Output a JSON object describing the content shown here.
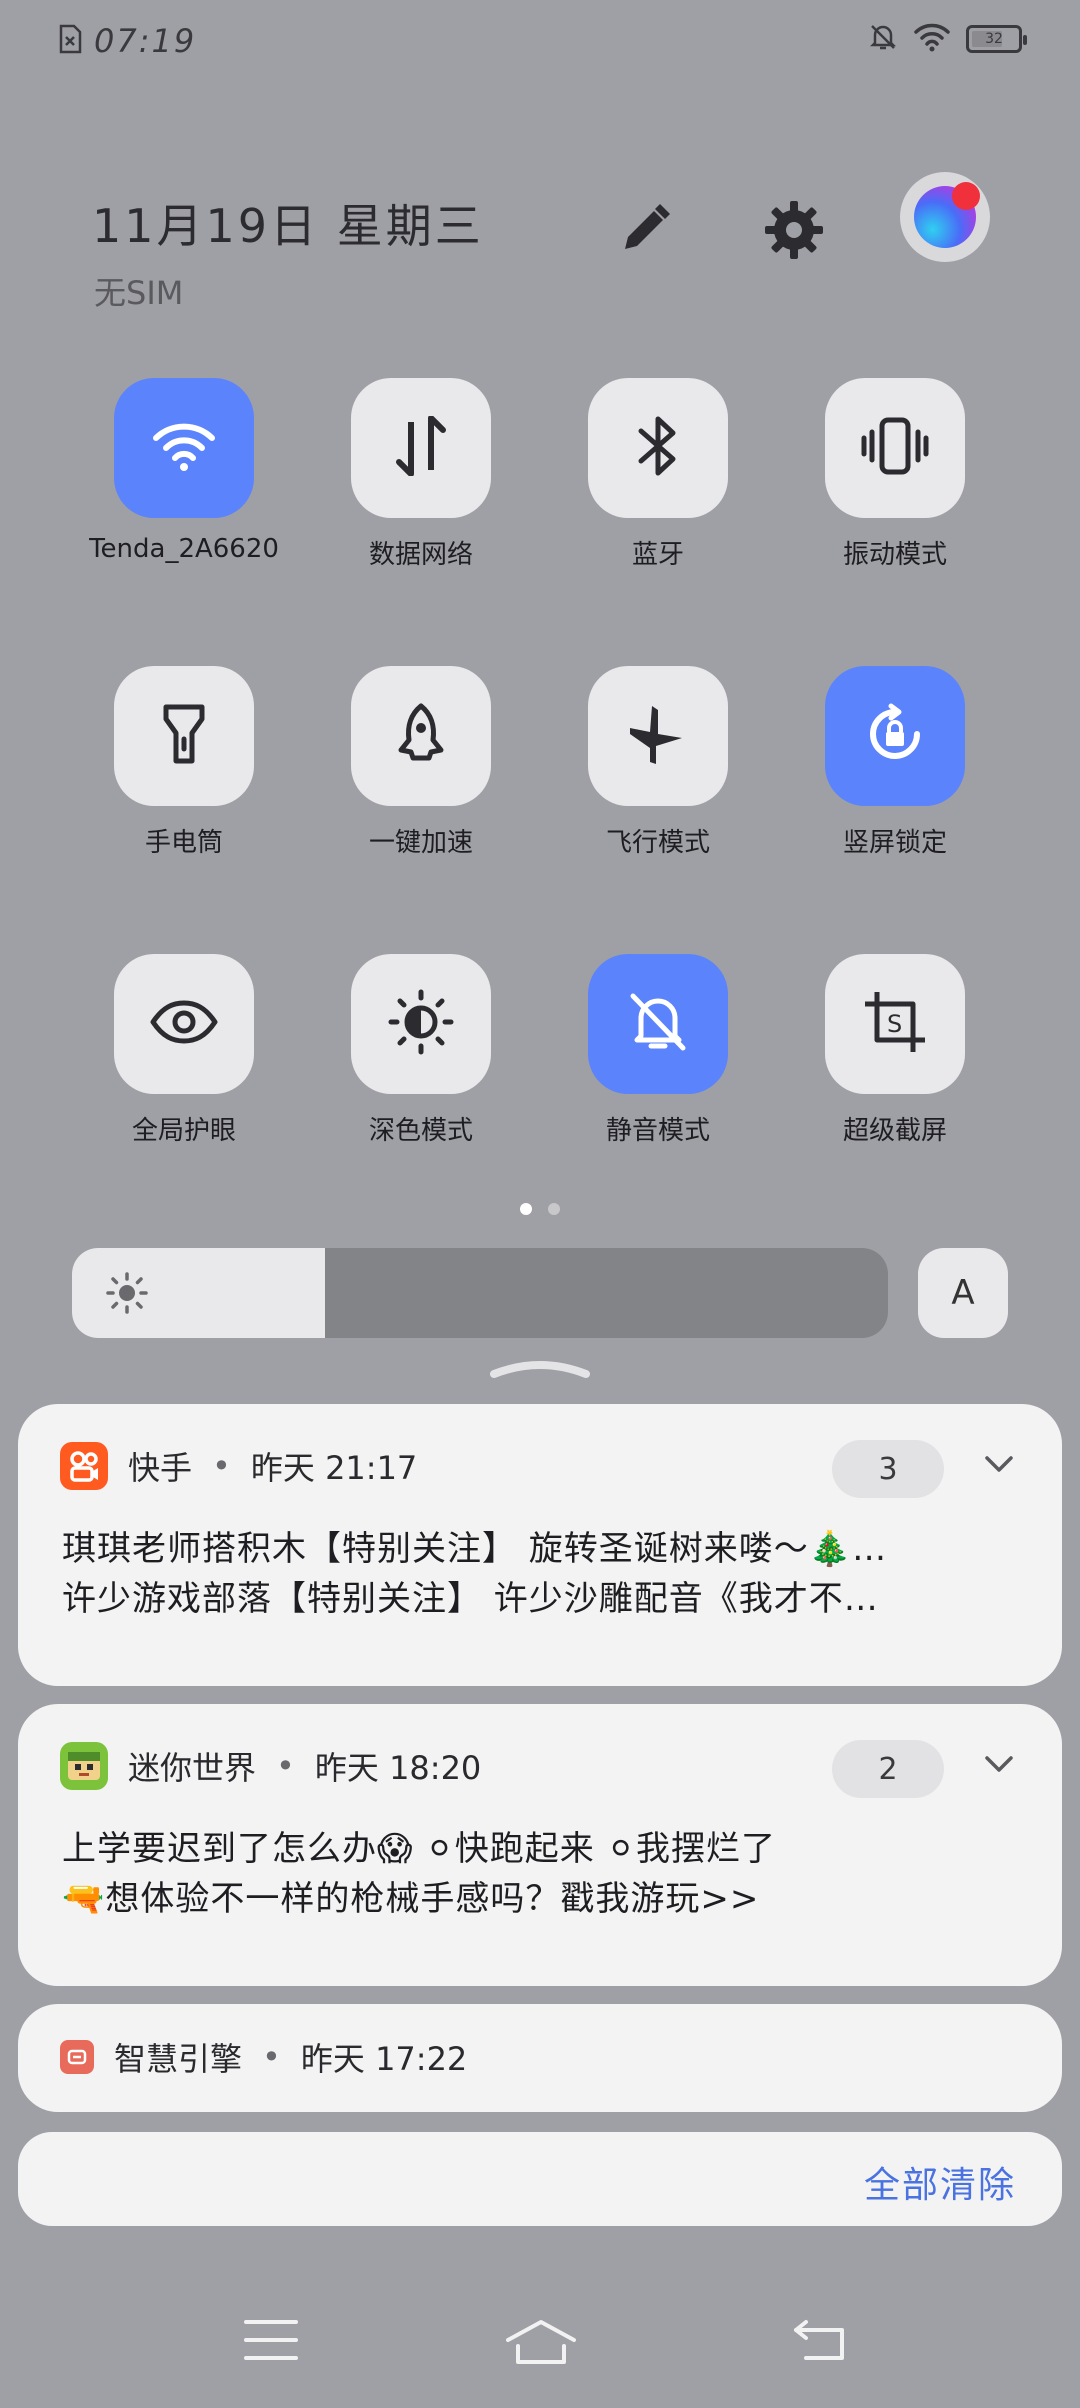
{
  "status_bar": {
    "time": "07:19",
    "battery_level": "32",
    "icons": [
      "sim-error-icon",
      "bell-off-icon",
      "wifi-icon",
      "battery-icon"
    ]
  },
  "header": {
    "date": "11月19日 星期三",
    "sim_status": "无SIM",
    "icons": [
      "edit-icon",
      "settings-icon",
      "avatar"
    ]
  },
  "tiles": [
    {
      "label": "Tenda_2A6620",
      "icon": "wifi-icon",
      "active": true
    },
    {
      "label": "数据网络",
      "icon": "data-network-icon",
      "active": false
    },
    {
      "label": "蓝牙",
      "icon": "bluetooth-icon",
      "active": false
    },
    {
      "label": "振动模式",
      "icon": "vibrate-icon",
      "active": false
    },
    {
      "label": "手电筒",
      "icon": "flashlight-icon",
      "active": false
    },
    {
      "label": "一键加速",
      "icon": "rocket-icon",
      "active": false
    },
    {
      "label": "飞行模式",
      "icon": "airplane-icon",
      "active": false
    },
    {
      "label": "竖屏锁定",
      "icon": "rotation-lock-icon",
      "active": true
    },
    {
      "label": "全局护眼",
      "icon": "eye-icon",
      "active": false
    },
    {
      "label": "深色模式",
      "icon": "dark-mode-icon",
      "active": false
    },
    {
      "label": "静音模式",
      "icon": "bell-off-icon",
      "active": true
    },
    {
      "label": "超级截屏",
      "icon": "screenshot-crop-icon",
      "active": false
    }
  ],
  "page_indicator": {
    "pages": 2,
    "current": 1
  },
  "brightness": {
    "level": 0.31,
    "auto_label": "A"
  },
  "notifications": [
    {
      "app": "快手",
      "time": "昨天 21:17",
      "count": "3",
      "lines": [
        "琪琪老师搭积木【特别关注】 旋转圣诞树来喽～🎄…",
        "许少游戏部落【特别关注】 许少沙雕配音《我才不…"
      ],
      "icon": "kuaishou-icon"
    },
    {
      "app": "迷你世界",
      "time": "昨天 18:20",
      "count": "2",
      "lines": [
        "上学要迟到了怎么办😱 ⚪快跑起来 ⚪我摆烂了",
        "🔫想体验不一样的枪械手感吗？戳我游玩>>"
      ],
      "icon": "mini-world-icon"
    },
    {
      "app": "智慧引擎",
      "time": "昨天 17:22",
      "icon": "smart-engine-icon"
    }
  ],
  "clear_all": "全部清除",
  "nav": [
    "menu-icon",
    "home-icon",
    "back-icon"
  ],
  "colors": {
    "accent": "#5b83fb",
    "tile": "#e9e9eb",
    "background": "#9fa0a5",
    "clear": "#4a72e0",
    "kuaishou": "#ff5a1f"
  }
}
